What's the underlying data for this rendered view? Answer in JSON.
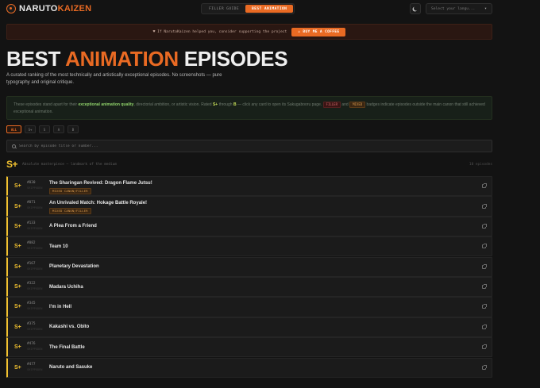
{
  "header": {
    "logo_a": "NARUTO",
    "logo_b": "KAIZEN",
    "nav": [
      {
        "label": "FILLER GUIDE",
        "active": false
      },
      {
        "label": "BEST ANIMATION",
        "active": true
      }
    ],
    "theme_icon": "moon-icon",
    "lang_placeholder": "Select your langu..."
  },
  "support": {
    "text": "♥ If NarutoKaizen helped you, consider supporting the project",
    "button": "☕ BUY ME A COFFEE"
  },
  "title": {
    "a": "BEST ",
    "b": "ANIMATION",
    "c": " EPISODES"
  },
  "subtitle": "A curated ranking of the most technically and artistically exceptional episodes. No screenshots — pure typography and original critique.",
  "info": {
    "t1": "These episodes stand apart for their ",
    "t2": "exceptional animation quality",
    "t3": ", directorial ambition, or artistic vision. Rated ",
    "t4": "S+",
    "t5": " through ",
    "t6": "B",
    "t7": " — click any card to open its Sakugabooru page. ",
    "filler": "FILLER",
    "t8": " and ",
    "mixed": "MIXED",
    "t9": " badges indicate episodes outside the main canon that still achieved exceptional animation."
  },
  "filters": [
    {
      "label": "ALL",
      "active": true
    },
    {
      "label": "S+",
      "active": false
    },
    {
      "label": "S",
      "active": false
    },
    {
      "label": "A",
      "active": false
    },
    {
      "label": "B",
      "active": false
    }
  ],
  "search": {
    "placeholder": "Search by episode title or number..."
  },
  "tier": {
    "mark": "S+",
    "desc": "Absolute masterpiece — landmark of the medium",
    "count": "10 episodes"
  },
  "episodes": [
    {
      "num": "#030",
      "sub": "SHIPPUDEN",
      "title": "The Sharingan Revived: Dragon Flame Jutsu!",
      "badge": "MIXED CANON/FILLER"
    },
    {
      "num": "#071",
      "sub": "SHIPPUDEN",
      "title": "An Unrivaled Match: Hokage Battle Royale!",
      "badge": "MIXED CANON/FILLER"
    },
    {
      "num": "#133",
      "sub": "SHIPPUDEN",
      "title": "A Plea From a Friend",
      "badge": ""
    },
    {
      "num": "#082",
      "sub": "SHIPPUDEN",
      "title": "Team 10",
      "badge": ""
    },
    {
      "num": "#167",
      "sub": "SHIPPUDEN",
      "title": "Planetary Devastation",
      "badge": ""
    },
    {
      "num": "#322",
      "sub": "SHIPPUDEN",
      "title": "Madara Uchiha",
      "badge": ""
    },
    {
      "num": "#345",
      "sub": "SHIPPUDEN",
      "title": "I'm in Hell",
      "badge": ""
    },
    {
      "num": "#375",
      "sub": "SHIPPUDEN",
      "title": "Kakashi vs. Obito",
      "badge": ""
    },
    {
      "num": "#476",
      "sub": "SHIPPUDEN",
      "title": "The Final Battle",
      "badge": ""
    },
    {
      "num": "#477",
      "sub": "SHIPPUDEN",
      "title": "Naruto and Sasuke",
      "badge": ""
    }
  ],
  "colors": {
    "accent": "#e96a23",
    "tier_splus": "#f2c230",
    "bg": "#131313"
  }
}
